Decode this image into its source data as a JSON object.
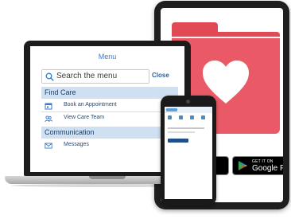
{
  "laptop": {
    "menu_title": "Menu",
    "search": {
      "placeholder": "Search the menu",
      "close_label": "Close"
    },
    "sections": [
      {
        "title": "Find Care",
        "items": [
          {
            "label": "Book an Appointment",
            "icon": "calendar-icon"
          },
          {
            "label": "View Care Team",
            "icon": "people-icon"
          }
        ]
      },
      {
        "title": "Communication",
        "items": [
          {
            "label": "Messages",
            "icon": "envelope-icon"
          }
        ]
      }
    ]
  },
  "tablet": {
    "graphic": "red-folder-with-heart",
    "google_play": {
      "small": "GET IT ON",
      "big": "Google Play"
    }
  },
  "colors": {
    "accent_blue": "#3a79c4",
    "section_bg": "#cfe0f3",
    "folder_red": "#ea5a66"
  }
}
